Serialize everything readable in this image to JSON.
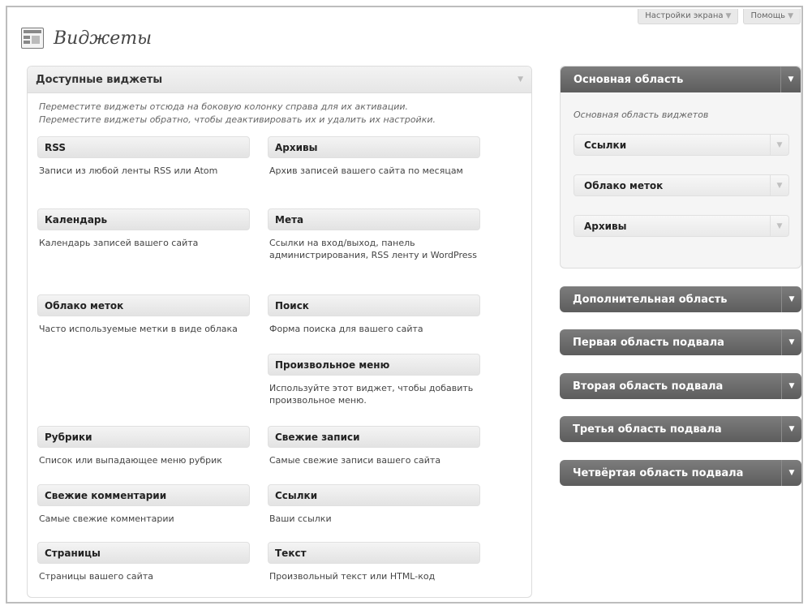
{
  "top_buttons": {
    "screen_options": "Настройки экрана",
    "help": "Помощь",
    "arrow": "▼"
  },
  "page": {
    "title": "Виджеты"
  },
  "available": {
    "title": "Доступные виджеты",
    "desc_line1": "Переместите виджеты отсюда на боковую колонку справа для их активации.",
    "desc_line2": "Переместите виджеты обратно, чтобы деактивировать их и удалить их настройки.",
    "widgets": [
      {
        "title": "RSS",
        "desc": "Записи из любой ленты RSS или Atom"
      },
      {
        "title": "Архивы",
        "desc": "Архив записей вашего сайта по месяцам"
      },
      {
        "title": "Календарь",
        "desc": "Календарь записей вашего сайта"
      },
      {
        "title": "Мета",
        "desc": "Ссылки на вход/выход, панель администрирования, RSS ленту и WordPress"
      },
      {
        "title": "Облако меток",
        "desc": "Часто используемые метки в виде облака"
      },
      {
        "title": "Поиск",
        "desc": "Форма поиска для вашего сайта"
      },
      {
        "title": "Произвольное меню",
        "desc": "Используйте этот виджет, чтобы добавить произвольное меню."
      },
      {
        "title": "Рубрики",
        "desc": "Список или выпадающее меню рубрик"
      },
      {
        "title": "Свежие записи",
        "desc": "Самые свежие записи вашего сайта"
      },
      {
        "title": "Свежие комментарии",
        "desc": "Самые свежие комментарии"
      },
      {
        "title": "Ссылки",
        "desc": "Ваши ссылки"
      },
      {
        "title": "Страницы",
        "desc": "Страницы вашего сайта"
      },
      {
        "title": "Текст",
        "desc": "Произвольный текст или HTML-код"
      }
    ]
  },
  "sidebars": {
    "main": {
      "title": "Основная область",
      "desc": "Основная область виджетов",
      "placed": [
        "Ссылки",
        "Облако меток",
        "Архивы"
      ]
    },
    "others": [
      "Дополнительная область",
      "Первая область подвала",
      "Вторая область подвала",
      "Третья область подвала",
      "Четвёртая область подвала"
    ]
  }
}
